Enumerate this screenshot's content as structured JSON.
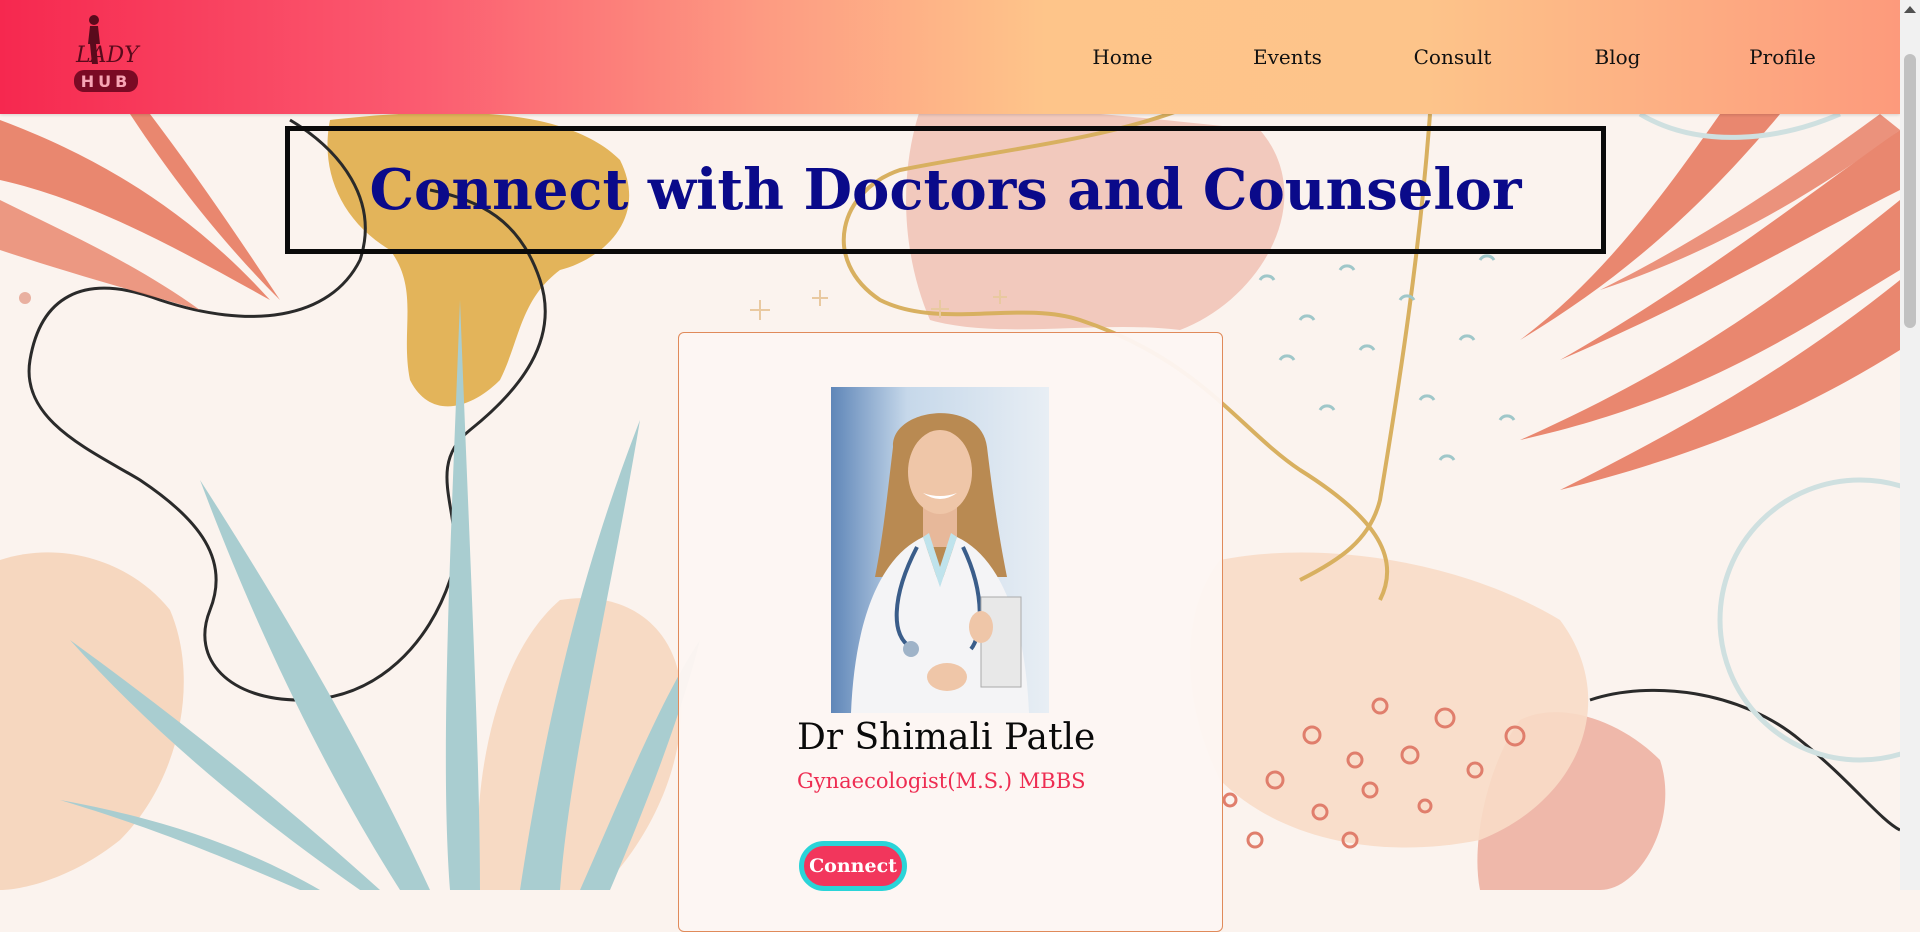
{
  "nav": {
    "logo_text_top": "LADY",
    "logo_text_bottom": "HUB",
    "links": [
      "Home",
      "Events",
      "Consult",
      "Blog",
      "Profile"
    ]
  },
  "hero": {
    "title": "Connect with Doctors and Counselor"
  },
  "doctor": {
    "name": "Dr Shimali Patle",
    "qualification": "Gynaecologist(M.S.) MBBS",
    "connect_label": "Connect"
  },
  "colors": {
    "accent": "#f2365c",
    "title": "#0a0a8a",
    "button_ring": "#2ad4d8"
  }
}
